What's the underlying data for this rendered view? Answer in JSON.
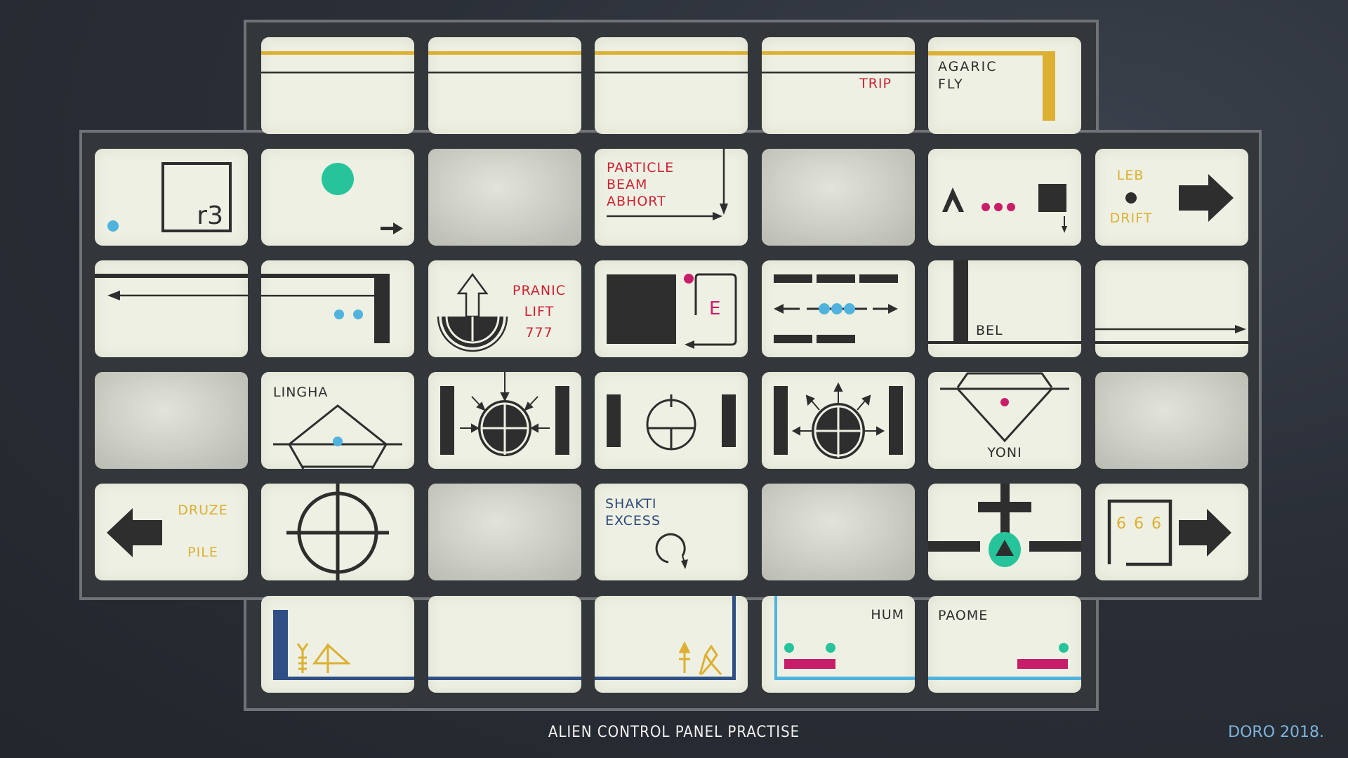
{
  "footer": {
    "title": "ALIEN CONTROL PANEL PRACTISE",
    "credit": "DORO 2018."
  },
  "colors": {
    "tile": "#eef0e3",
    "ink": "#2e2e2e",
    "yellow": "#dcb032",
    "red": "#cc2233",
    "magenta": "#c81e6a",
    "blue": "#4fb3dd",
    "teal": "#27c49c",
    "navy": "#2f4f85",
    "panel": "#33363b",
    "frame": "#6f7276"
  },
  "labels": {
    "trip": "TRIP",
    "agaric": "AGARIC",
    "fly": "FLY",
    "r3": "r3",
    "particle": "PARTICLE",
    "beam": "BEAM",
    "abhort": "ABHORT",
    "leb": "LEB",
    "drift": "DRIFT",
    "pranic": "PRANIC",
    "lift": "LIFT",
    "n777": "777",
    "e": "E",
    "bel": "BEL",
    "lingha": "LINGHA",
    "yoni": "YONI",
    "druze": "DRUZE",
    "pile": "PILE",
    "shakti": "SHAKTI",
    "excess": "EXCESS",
    "n666": "6 6 6",
    "hum": "HUM",
    "paome": "PAOME"
  }
}
